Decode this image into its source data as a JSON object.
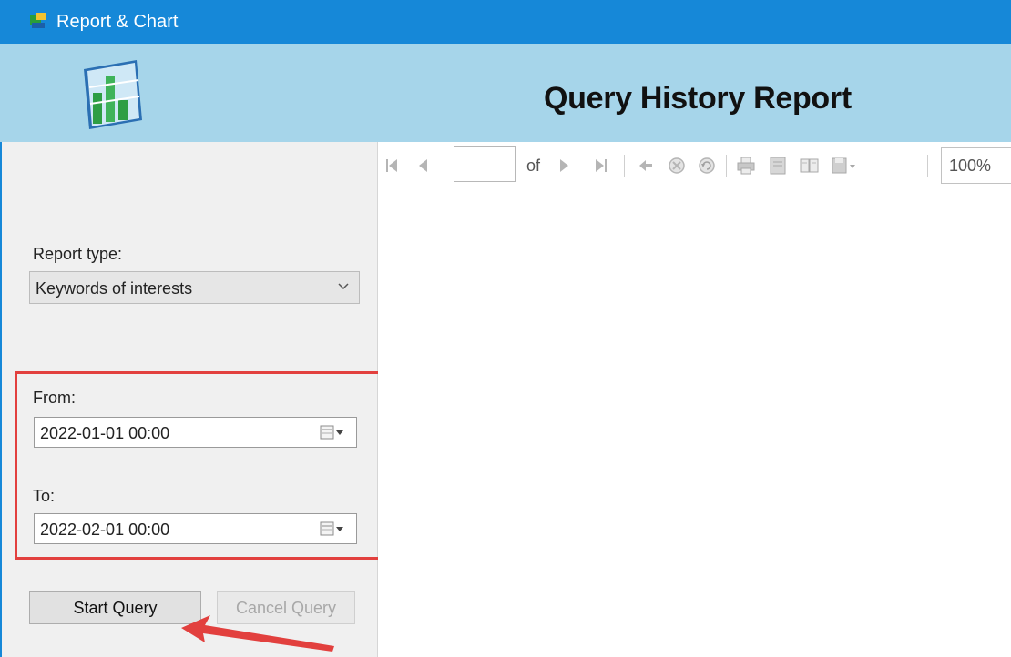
{
  "window": {
    "title": "Report & Chart"
  },
  "header": {
    "report_title": "Query History Report"
  },
  "report_viewer": {
    "toolbar": {
      "page_number": "",
      "of_label": "of",
      "zoom": "100%",
      "buttons": [
        "first-page",
        "previous-page",
        "next-page",
        "last-page",
        "back",
        "stop",
        "refresh",
        "print",
        "print-layout",
        "page-setup",
        "export"
      ]
    }
  },
  "query_panel": {
    "report_type_label": "Report type:",
    "report_type_value": "Keywords of interests",
    "from_label": "From:",
    "from_value": "2022-01-01 00:00",
    "to_label": "To:",
    "to_value": "2022-02-01 00:00",
    "start_button": "Start Query",
    "cancel_button": "Cancel Query"
  },
  "colors": {
    "titlebar": "#1688d8",
    "header": "#a6d5ea",
    "highlight": "#e2403e"
  }
}
